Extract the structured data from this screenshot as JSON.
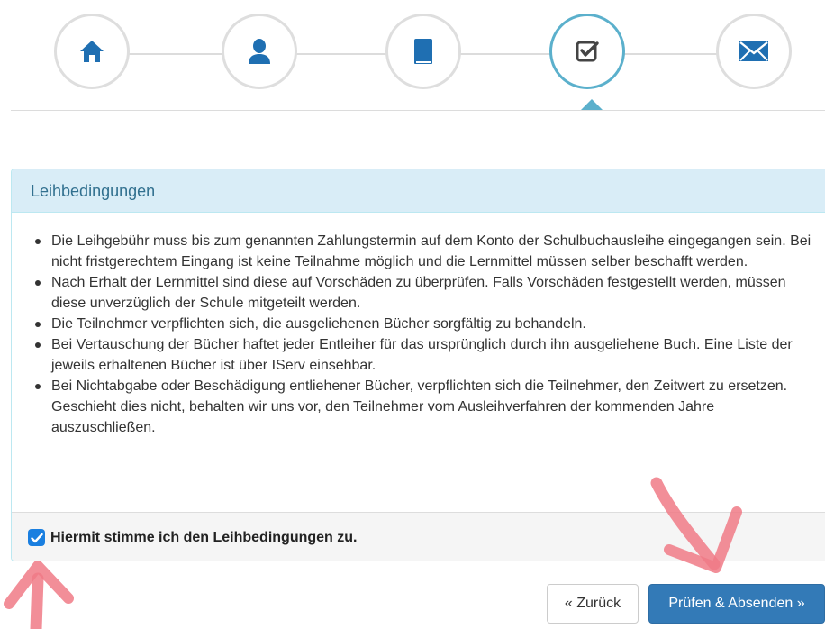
{
  "stepper": {
    "steps": [
      {
        "name": "home",
        "icon": "home-icon",
        "active": false
      },
      {
        "name": "person",
        "icon": "user-icon",
        "active": false
      },
      {
        "name": "book",
        "icon": "book-icon",
        "active": false
      },
      {
        "name": "check",
        "icon": "check-square-icon",
        "active": true
      },
      {
        "name": "mail",
        "icon": "envelope-icon",
        "active": false
      }
    ],
    "active_step": 4
  },
  "panel": {
    "title": "Leihbedingungen",
    "items": [
      "Die Leihgebühr muss bis zum genannten Zahlungstermin auf dem Konto der Schulbuchausleihe eingegangen sein. Bei nicht fristgerechtem Eingang ist keine Teilnahme möglich und die Lernmittel müssen selber beschafft werden.",
      "Nach Erhalt der Lernmittel sind diese auf Vorschäden zu überprüfen. Falls Vorschäden festgestellt werden, müssen diese unverzüglich der Schule mitgeteilt werden.",
      "Die Teilnehmer verpflichten sich, die ausgeliehenen Bücher sorgfältig zu behandeln.",
      "Bei Vertauschung der Bücher haftet jeder Entleiher für das ursprünglich durch ihn ausgeliehene Buch. Eine Liste der jeweils erhaltenen Bücher ist über IServ einsehbar.",
      "Bei Nichtabgabe oder Beschädigung entliehener Bücher, verpflichten sich die Teilnehmer, den Zeitwert zu ersetzen. Geschieht dies nicht, behalten wir uns vor, den Teilnehmer vom Ausleihverfahren der kommenden Jahre auszuschließen."
    ],
    "agree_label": "Hiermit stimme ich den Leihbedingungen zu.",
    "agree_checked": true
  },
  "buttons": {
    "back": "« Zurück",
    "submit": "Prüfen & Absenden »"
  },
  "colors": {
    "icon_blue": "#1f6fb2",
    "active_ring": "#5bb0cc",
    "heading_bg": "#d9edf7",
    "heading_text": "#31708f",
    "primary": "#337ab7",
    "checkbox": "#1a7fe0",
    "annotation": "#f07a86"
  }
}
